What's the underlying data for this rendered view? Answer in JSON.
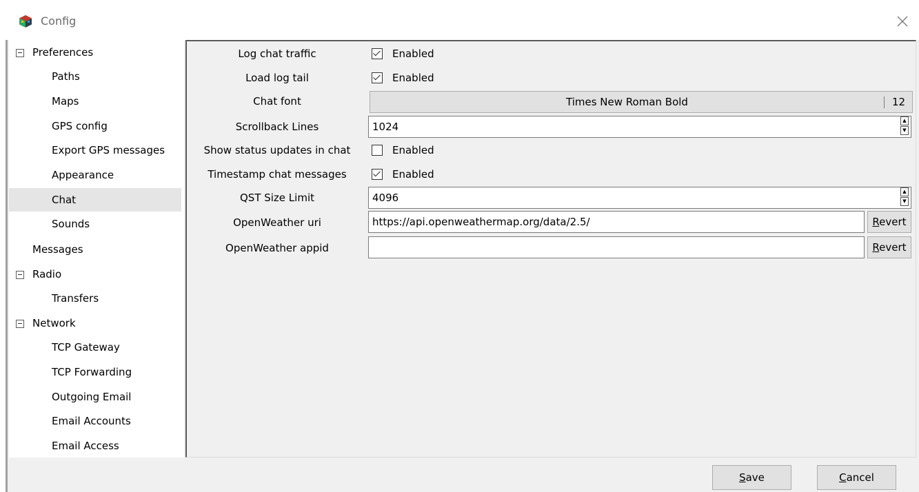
{
  "window": {
    "title": "Config",
    "icon": "app-cube-icon",
    "close_glyph": "✕"
  },
  "tree": {
    "items": [
      {
        "label": "Preferences",
        "expandable": true,
        "level": 0
      },
      {
        "label": "Paths",
        "level": 1
      },
      {
        "label": "Maps",
        "level": 1
      },
      {
        "label": "GPS config",
        "level": 1
      },
      {
        "label": "Export GPS messages",
        "level": 1
      },
      {
        "label": "Appearance",
        "level": 1
      },
      {
        "label": "Chat",
        "level": 1,
        "selected": true
      },
      {
        "label": "Sounds",
        "level": 1
      },
      {
        "label": "Messages",
        "level": 0
      },
      {
        "label": "Radio",
        "expandable": true,
        "level": 0
      },
      {
        "label": "Transfers",
        "level": 1
      },
      {
        "label": "Network",
        "expandable": true,
        "level": 0
      },
      {
        "label": "TCP Gateway",
        "level": 1
      },
      {
        "label": "TCP Forwarding",
        "level": 1
      },
      {
        "label": "Outgoing Email",
        "level": 1
      },
      {
        "label": "Email Accounts",
        "level": 1
      },
      {
        "label": "Email Access",
        "level": 1
      }
    ]
  },
  "form": {
    "log_chat_traffic": {
      "label": "Log chat traffic",
      "checkbox_label": "Enabled",
      "checked": true
    },
    "load_log_tail": {
      "label": "Load log tail",
      "checkbox_label": "Enabled",
      "checked": true
    },
    "chat_font": {
      "label": "Chat font",
      "font_name": "Times New Roman Bold",
      "font_size": "12"
    },
    "scrollback_lines": {
      "label": "Scrollback Lines",
      "value": "1024"
    },
    "show_status_updates": {
      "label": "Show status updates in chat",
      "checkbox_label": "Enabled",
      "checked": false
    },
    "timestamp_chat": {
      "label": "Timestamp chat messages",
      "checkbox_label": "Enabled",
      "checked": true
    },
    "qst_size_limit": {
      "label": "QST Size Limit",
      "value": "4096"
    },
    "openweather_uri": {
      "label": "OpenWeather uri",
      "value": "https://api.openweathermap.org/data/2.5/",
      "revert_first": "R",
      "revert_rest": "evert"
    },
    "openweather_appid": {
      "label": "OpenWeather appid",
      "value": "",
      "revert_first": "R",
      "revert_rest": "evert"
    }
  },
  "buttons": {
    "save_first": "S",
    "save_rest": "ave",
    "cancel_first": "C",
    "cancel_rest": "ancel"
  }
}
